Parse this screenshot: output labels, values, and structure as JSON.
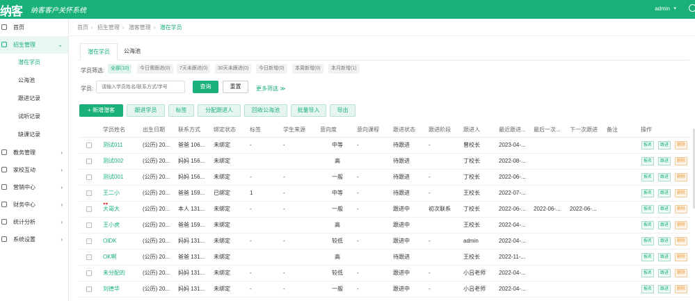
{
  "brand": {
    "logo": "纳客",
    "slogan": "纳客客户关怀系统",
    "user": "admin"
  },
  "sidebar": {
    "items": [
      {
        "label": "首页",
        "icon": "home-icon"
      },
      {
        "label": "招生管理",
        "icon": "recruit-icon",
        "open": true
      }
    ],
    "sub_items": [
      "潜在学员",
      "公海池",
      "跟进记录",
      "试听记录",
      "缺课记录"
    ],
    "more_items": [
      {
        "label": "教务管理",
        "icon": "academic-icon"
      },
      {
        "label": "家校互动",
        "icon": "interact-icon"
      },
      {
        "label": "营销中心",
        "icon": "marketing-icon"
      },
      {
        "label": "财务中心",
        "icon": "finance-icon"
      },
      {
        "label": "统计分析",
        "icon": "stats-icon"
      },
      {
        "label": "系统设置",
        "icon": "settings-icon"
      }
    ]
  },
  "breadcrumb": [
    "首页",
    "招生管理",
    "潜客管理",
    "潜在学员"
  ],
  "tabs": [
    "潜在学员",
    "公海池"
  ],
  "filter": {
    "label": "学员筛选:",
    "chips": [
      "全部(10)",
      "今日需跟进(0)",
      "7天未跟进(0)",
      "30天未跟进(0)",
      "今日新增(0)",
      "本周新增(0)",
      "本月新增(1)"
    ]
  },
  "search": {
    "label": "学员:",
    "placeholder": "请输入学员姓名/联系方式/学号",
    "query_button": "查询",
    "reset_button": "重置",
    "more_filter": "更多筛选 ≫"
  },
  "actions": [
    "+ 新增潜客",
    "跟进学员",
    "标签",
    "分配跟进人",
    "回收公海池",
    "批量导入",
    "导出"
  ],
  "table": {
    "headers": [
      "学员姓名",
      "出生日期",
      "联系方式",
      "绑定状态",
      "标签",
      "学生来源",
      "意向度",
      "意向课程",
      "跟进状态",
      "跟进阶段",
      "跟进人",
      "最近跟进...",
      "最后一次...",
      "下一次跟进",
      "备注",
      "操作"
    ],
    "rows": [
      [
        "测试011",
        "(公历) 20...",
        "爸爸 106...",
        "未绑定",
        "-",
        "-",
        "中等",
        "-",
        "待跟进",
        "-",
        "曾校长",
        "2023-04-...",
        "",
        "",
        "",
        ""
      ],
      [
        "测试002",
        "(公历) 20...",
        "妈妈 156...",
        "未绑定",
        "",
        "",
        "高",
        "",
        "待跟进",
        "",
        "丁校长",
        "2022-08-...",
        "",
        "",
        "",
        ""
      ],
      [
        "测试001",
        "(公历) 20...",
        "妈妈 156...",
        "未绑定",
        "-",
        "-",
        "一般",
        "-",
        "待跟进",
        "-",
        "丁校长",
        "2022-06-...",
        "",
        "",
        "",
        ""
      ],
      [
        "王二小",
        "(公历) 20...",
        "爸爸 159...",
        "已绑定",
        "1",
        "-",
        "中等",
        "-",
        "待跟进",
        "-",
        "王校长",
        "2022-07-...",
        "",
        "",
        "",
        ""
      ],
      [
        "大哥大",
        "(公历) 20...",
        "本人 131...",
        "未绑定",
        "-",
        "-",
        "一般",
        "-",
        "跟进中",
        "初次联系",
        "丁校长",
        "2022-06-...",
        "2022-06-...",
        "2022-06-...",
        "",
        ""
      ],
      [
        "王小虎",
        "(公历) 20...",
        "爸爸 159...",
        "未绑定",
        "",
        "",
        "高",
        "",
        "跟进中",
        "",
        "王校长",
        "2022-04-...",
        "",
        "",
        "",
        ""
      ],
      [
        "OIDK",
        "(公历) 20...",
        "妈妈 131...",
        "未绑定",
        "-",
        "-",
        "较低",
        "-",
        "跟进中",
        "-",
        "admin",
        "2022-04-...",
        "",
        "",
        "",
        ""
      ],
      [
        "OK啊",
        "(公历) 20...",
        "爸爸 131...",
        "未绑定",
        "",
        "",
        "高",
        "",
        "待跟进",
        "",
        "王校长",
        "2022-11-...",
        "",
        "",
        "",
        ""
      ],
      [
        "未分配的",
        "(公历) 20...",
        "妈妈 131...",
        "未绑定",
        "-",
        "-",
        "较低",
        "-",
        "跟进中",
        "-",
        "小吕老师",
        "2022-04-...",
        "",
        "",
        "",
        ""
      ],
      [
        "刘德华",
        "(公历) 20...",
        "妈妈 131...",
        "未绑定",
        "-",
        "-",
        "一般",
        "-",
        "跟进中",
        "-",
        "小吕老师",
        "2022-04-...",
        "",
        "",
        "",
        ""
      ]
    ],
    "ops": [
      "报名",
      "跟进",
      "删除"
    ]
  }
}
